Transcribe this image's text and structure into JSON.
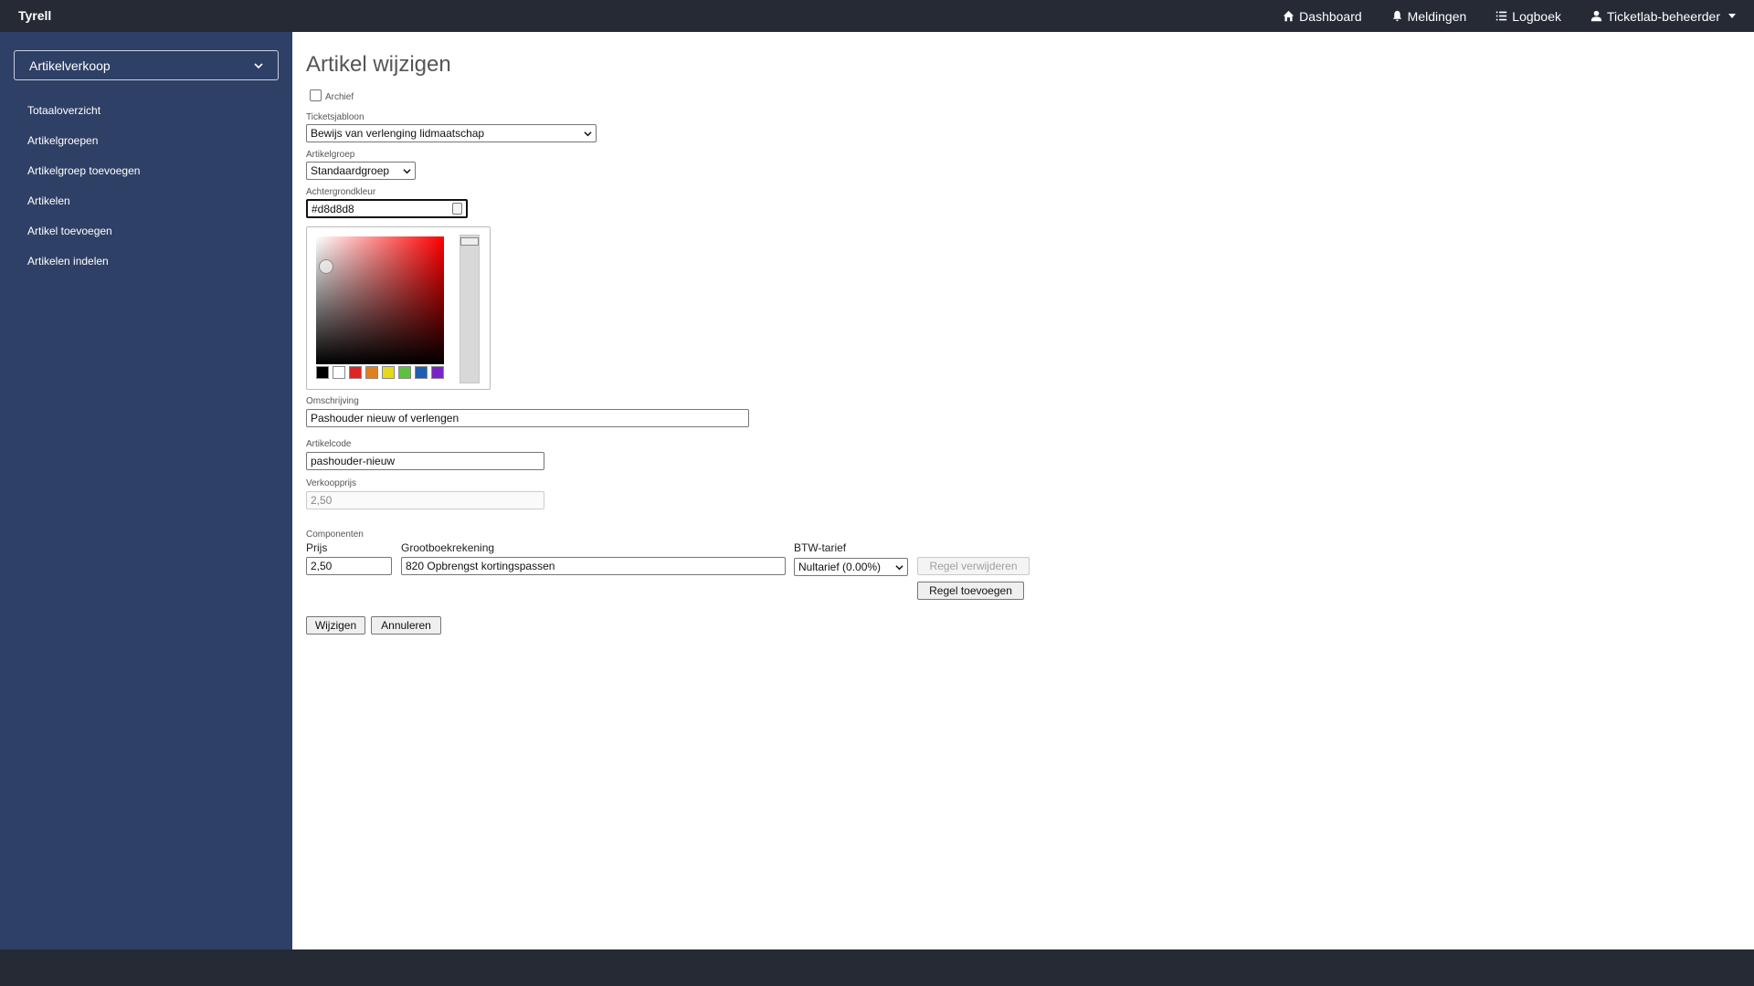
{
  "app": {
    "brand": "Tyrell"
  },
  "topnav": [
    {
      "label": "Dashboard",
      "icon": "home-icon"
    },
    {
      "label": "Meldingen",
      "icon": "bell-icon"
    },
    {
      "label": "Logboek",
      "icon": "list-icon"
    },
    {
      "label": "Ticketlab-beheerder",
      "icon": "user-icon"
    }
  ],
  "sidebar": {
    "module": "Artikelverkoop",
    "items": [
      {
        "label": "Totaaloverzicht"
      },
      {
        "label": "Artikelgroepen"
      },
      {
        "label": "Artikelgroep toevoegen"
      },
      {
        "label": "Artikelen"
      },
      {
        "label": "Artikel toevoegen"
      },
      {
        "label": "Artikelen indelen"
      }
    ]
  },
  "page": {
    "title": "Artikel wijzigen"
  },
  "form": {
    "archive_label": "Archief",
    "ticket_template": {
      "label": "Ticketsjabloon",
      "value": "Bewijs van verlenging lidmaatschap"
    },
    "article_group": {
      "label": "Artikelgroep",
      "value": "Standaardgroep"
    },
    "background_color": {
      "label": "Achtergrondkleur",
      "value": "#d8d8d8"
    },
    "description": {
      "label": "Omschrijving",
      "value": "Pashouder nieuw of verlengen"
    },
    "article_code": {
      "label": "Artikelcode",
      "value": "pashouder-nieuw"
    },
    "sale_price": {
      "label": "Verkoopprijs",
      "value": "2,50"
    },
    "components": {
      "label": "Componenten",
      "headers": {
        "price": "Prijs",
        "ledger": "Grootboekrekening",
        "vat": "BTW-tarief"
      },
      "row": {
        "price": "2,50",
        "ledger": "820 Opbrengst kortingspassen",
        "vat": "Nultarief (0.00%)"
      },
      "remove_label": "Regel verwijderen",
      "add_label": "Regel toevoegen"
    },
    "submit_label": "Wijzigen",
    "cancel_label": "Annuleren"
  },
  "swatch_colors": [
    "#000000",
    "#ffffff",
    "#e02424",
    "#e0801c",
    "#e8d81c",
    "#5cc23c",
    "#1c5fb4",
    "#7a24c8"
  ]
}
